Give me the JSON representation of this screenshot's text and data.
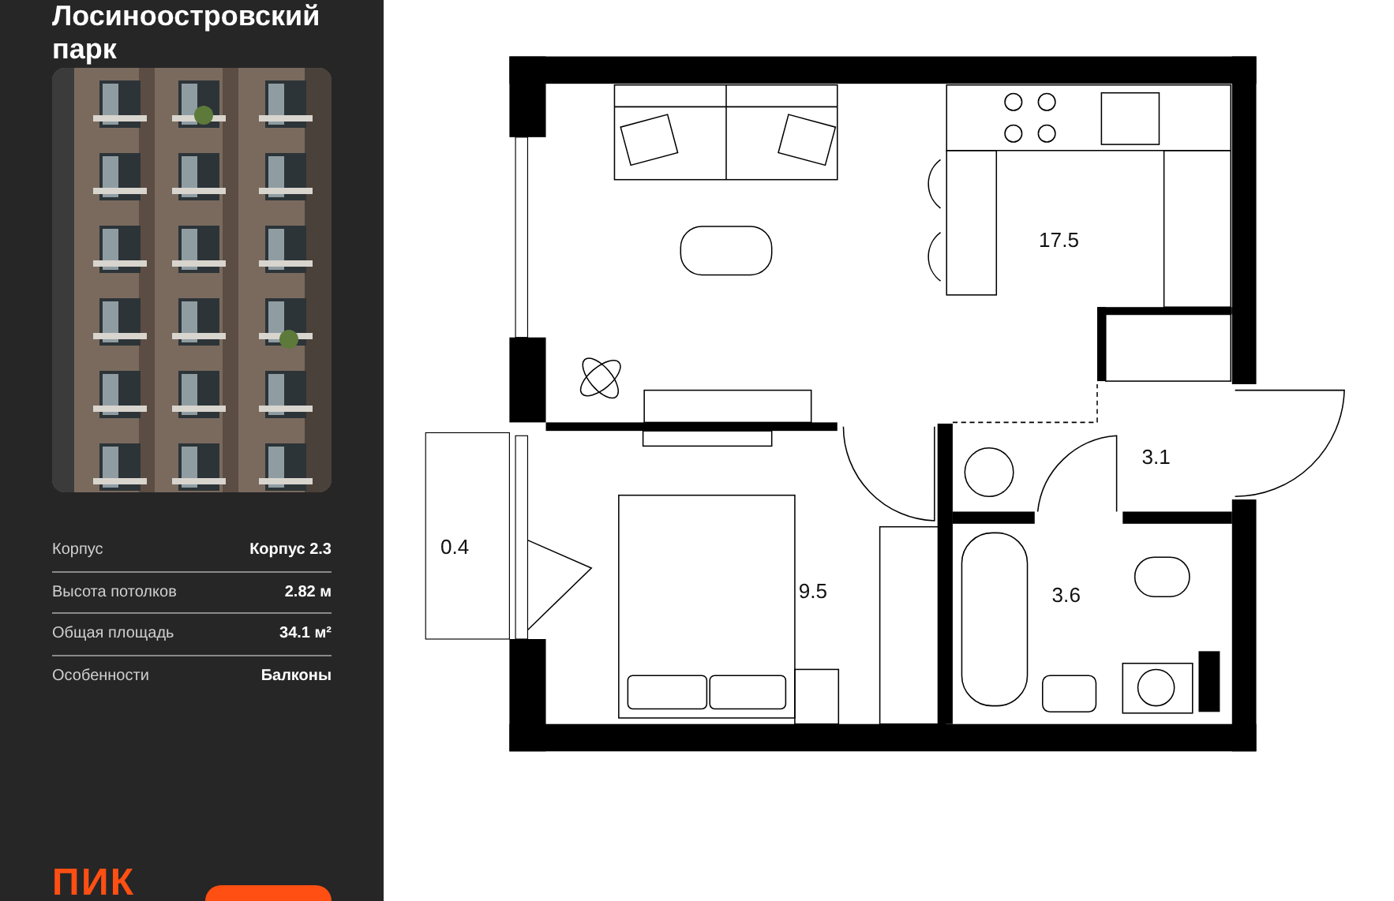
{
  "sidebar": {
    "title_lines": [
      "Лосиноостровский",
      "парк"
    ],
    "specs": [
      {
        "label": "Корпус",
        "value": "Корпус 2.3"
      },
      {
        "label": "Высота потолков",
        "value": "2.82 м"
      },
      {
        "label": "Общая площадь",
        "value": "34.1 м²"
      },
      {
        "label": "Особенности",
        "value": "Балконы"
      }
    ],
    "logo": "ПИК"
  },
  "plan": {
    "rooms": [
      {
        "area": "17.5"
      },
      {
        "area": "3.1"
      },
      {
        "area": "0.4"
      },
      {
        "area": "9.5"
      },
      {
        "area": "3.6"
      }
    ]
  }
}
